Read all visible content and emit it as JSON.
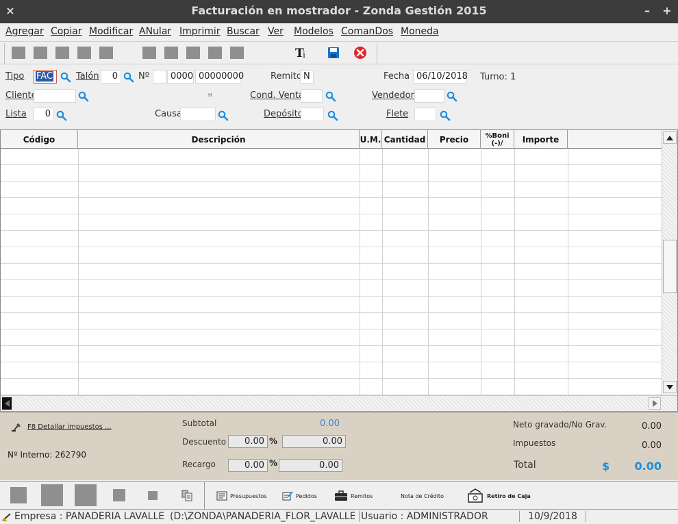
{
  "window": {
    "title": "Facturación en mostrador - Zonda Gestión 2015",
    "close": "×",
    "minimize": "–",
    "maximize": "+"
  },
  "menu": [
    "Agregar",
    "Copiar",
    "Modificar",
    "ANular",
    "Imprimir",
    "Buscar",
    "Ver",
    "Modelos",
    "ComanDos",
    "Moneda"
  ],
  "header": {
    "tipo_label": "Tipo",
    "tipo_value": "FAC",
    "talon_label": "Talón",
    "talon_value": "0",
    "numero_label": "Nº",
    "numero_prefix": "0000",
    "numero_value": "00000000",
    "remito_label": "Remito",
    "remito_value": "N",
    "fecha_label": "Fecha",
    "fecha_value": "06/10/2018",
    "turno_label": "Turno: 1",
    "cliente_label": "Cliente",
    "cliente_value": "",
    "cond_venta_label": "Cond. Venta",
    "cond_venta_value": "",
    "vendedor_label": "Vendedor",
    "vendedor_value": "",
    "small_mark": "H",
    "lista_label": "Lista",
    "lista_value": "0",
    "causa_label": "Causa",
    "causa_value": "",
    "deposito_label": "Depósito",
    "deposito_value": "",
    "flete_label": "Flete",
    "flete_value": ""
  },
  "grid": {
    "columns": [
      "Código",
      "Descripción",
      "U.M.",
      "Cantidad",
      "Precio",
      "%Boni(-)/",
      "Importe"
    ],
    "rows": []
  },
  "totals": {
    "f8_label": "F8 Detallar impuestos ...",
    "interno_label": "Nº Interno: 262790",
    "subtotal_label": "Subtotal",
    "subtotal_value": "0.00",
    "descuento_label": "Descuento",
    "descuento_pct": "0.00",
    "descuento_value": "0.00",
    "recargo_label": "Recargo",
    "recargo_pct": "0.00",
    "recargo_value": "0.00",
    "pct_symbol": "%",
    "neto_label": "Neto gravado/No Grav.",
    "neto_value": "0.00",
    "impuestos_label": "Impuestos",
    "impuestos_value": "0.00",
    "total_label": "Total",
    "currency": "$",
    "total_value": "0.00"
  },
  "bottom_buttons": [
    "Presupuestos",
    "Pedidos",
    "Remitos",
    "Nota de Crédito",
    "Retiro de Caja"
  ],
  "status": {
    "empresa": "Empresa : PANADERIA LAVALLE",
    "path": "(D:\\ZONDA\\PANADERIA_FLOR_LAVALLE\\",
    "usuario": "Usuario : ADMINISTRADOR",
    "fecha": "10/9/2018"
  },
  "colors": {
    "accent_blue": "#1a8fe0",
    "close_red": "#e0272b",
    "totals_bg": "#d9d2c4",
    "titlebar": "#3c3c3c"
  }
}
